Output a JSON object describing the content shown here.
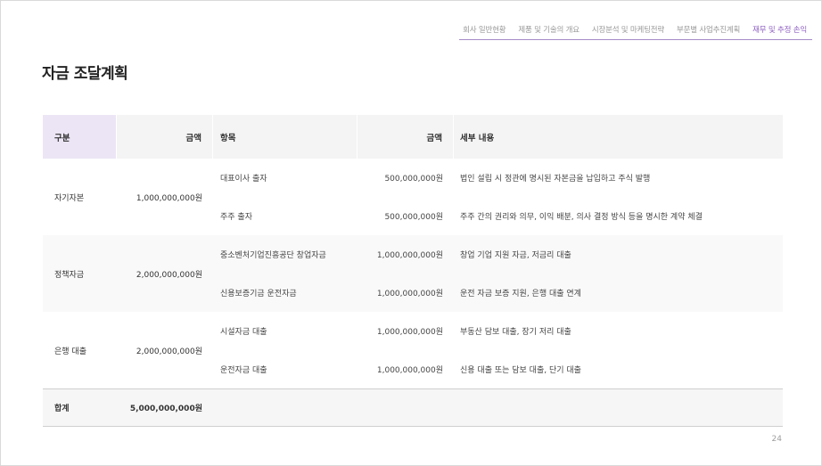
{
  "nav": [
    {
      "label": "회사 일반현황",
      "active": false
    },
    {
      "label": "제품 및 기술의 개요",
      "active": false
    },
    {
      "label": "시장분석 및 마케팅전략",
      "active": false
    },
    {
      "label": "부문별 사업추진계획",
      "active": false
    },
    {
      "label": "재무 및 추정 손익",
      "active": true
    }
  ],
  "title": "자금 조달계획",
  "table": {
    "headers": {
      "category": "구분",
      "amount": "금액",
      "item": "항목",
      "item_amount": "금액",
      "detail": "세부 내용"
    },
    "groups": [
      {
        "category": "자기자본",
        "amount": "1,000,000,000원",
        "rows": [
          {
            "item": "대표이사 출자",
            "amount": "500,000,000원",
            "detail": "법인 설립 시 정관에 명시된 자본금을 납입하고 주식 발행"
          },
          {
            "item": "주주 출자",
            "amount": "500,000,000원",
            "detail": "주주 간의 권리와 의무, 이익 배분, 의사 결정 방식 등을 명시한 계약 체결"
          }
        ]
      },
      {
        "category": "정책자금",
        "amount": "2,000,000,000원",
        "rows": [
          {
            "item": "중소벤처기업진흥공단 창업자금",
            "amount": "1,000,000,000원",
            "detail": "창업 기업 지원 자금, 저금리 대출"
          },
          {
            "item": "신용보증기금 운전자금",
            "amount": "1,000,000,000원",
            "detail": "운전 자금 보증 지원, 은행 대출 연계"
          }
        ]
      },
      {
        "category": "은행 대출",
        "amount": "2,000,000,000원",
        "rows": [
          {
            "item": "시설자금 대출",
            "amount": "1,000,000,000원",
            "detail": "부동산 담보 대출, 장기 저리 대출"
          },
          {
            "item": "운전자금 대출",
            "amount": "1,000,000,000원",
            "detail": "신용 대출 또는 담보 대출, 단기 대출"
          }
        ]
      }
    ],
    "total": {
      "label": "합계",
      "amount": "5,000,000,000원"
    }
  },
  "page_number": "24",
  "colors": {
    "accent": "#8e5fc2",
    "header_accent_bg": "#ece5f5",
    "header_bg": "#f4f4f4"
  }
}
